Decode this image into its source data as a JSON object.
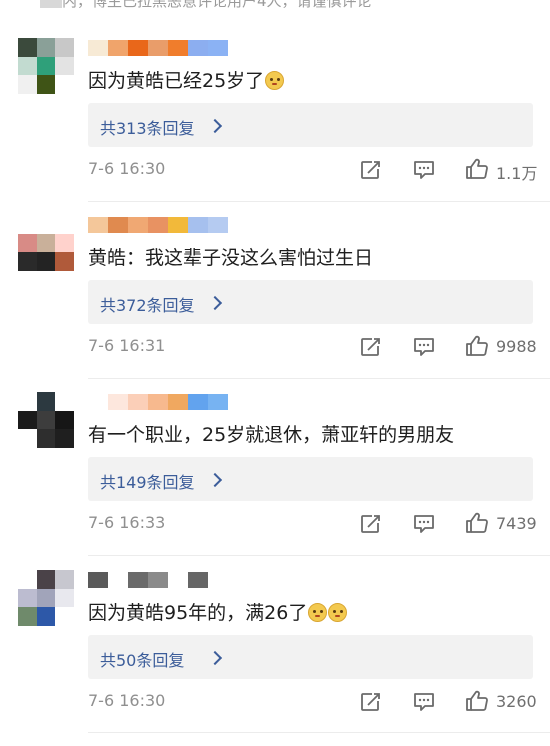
{
  "top_notice": "内，博主已拉黑恶意评论用户4人，请谨慎评论",
  "comments": [
    {
      "text": "因为黄皓已经25岁了",
      "emojis": [
        "doge-emoji"
      ],
      "reply_label": "共313条回复",
      "timestamp": "7-6 16:30",
      "likes": "1.1万",
      "avatar_colors": [
        "#3b4a3c",
        "#8aa098",
        "#c8c8c8",
        "#c2dbd0",
        "#2fa07a",
        "#e3e3e3",
        "#f0f0f0",
        "#3f5416",
        "#ffffff"
      ],
      "username_colors": [
        "#f7ead5",
        "#f0a46b",
        "#e9671a",
        "#e99d6a",
        "#f07d2c",
        "#8caef0",
        "#8bb2f4"
      ]
    },
    {
      "text": "黄皓：我这辈子没这么害怕过生日",
      "emojis": [],
      "reply_label": "共372条回复",
      "timestamp": "7-6 16:31",
      "likes": "9988",
      "avatar_colors": [
        "#ffffff",
        "#ffffff",
        "#ffffff",
        "#d88b86",
        "#c9b09a",
        "#ffd2cc",
        "#2a2a2a",
        "#232323",
        "#b05a3a"
      ],
      "username_colors": [
        "#f4c79a",
        "#e08a4f",
        "#f0a873",
        "#e89262",
        "#f2b93a",
        "#a6c0ee",
        "#b5cbf1"
      ]
    },
    {
      "text": "有一个职业，25岁就退休，萧亚轩的男朋友",
      "emojis": [],
      "reply_label": "共149条回复",
      "timestamp": "7-6 16:33",
      "likes": "7439",
      "avatar_colors": [
        "#ffffff",
        "#2c3940",
        "#ffffff",
        "#1b1b1b",
        "#3d3d3d",
        "#161616",
        "#ffffff",
        "#2e2e2e",
        "#1f1f1f"
      ],
      "username_colors": [
        "#ffffff",
        "#fde7dd",
        "#fbcfb8",
        "#f7b98e",
        "#f0a860",
        "#62a3ee",
        "#77b3f2"
      ]
    },
    {
      "text": "因为黄皓95年的，满26了",
      "emojis": [
        "doge-emoji",
        "doge-emoji"
      ],
      "reply_label": "共50条回复",
      "timestamp": "7-6 16:30",
      "likes": "3260",
      "avatar_colors": [
        "#ffffff",
        "#4a4248",
        "#c7c7cf",
        "#bcbcd0",
        "#a1a4ba",
        "#e8e8ee",
        "#6f8a6b",
        "#2d58a8",
        "#ffffff"
      ],
      "username_colors": [
        "#5a5a5a",
        "#ffffff",
        "#6a6a6a",
        "#8a8a8a",
        "#ffffff",
        "#666666",
        "#ffffff"
      ]
    }
  ]
}
